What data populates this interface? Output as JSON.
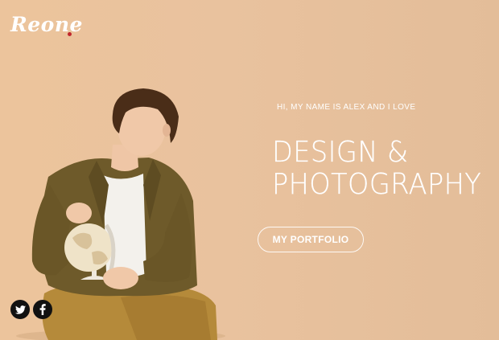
{
  "brand": {
    "logo_text": "Reone",
    "dot_color": "#c0262d"
  },
  "hero": {
    "intro": "HI, MY NAME IS ALEX AND I LOVE",
    "headline_line1": "DESIGN &",
    "headline_line2": "PHOTOGRAPHY",
    "cta_label": "MY PORTFOLIO",
    "background_color": "#e9c29e"
  },
  "social": [
    {
      "icon": "twitter-icon"
    },
    {
      "icon": "facebook-icon"
    }
  ]
}
